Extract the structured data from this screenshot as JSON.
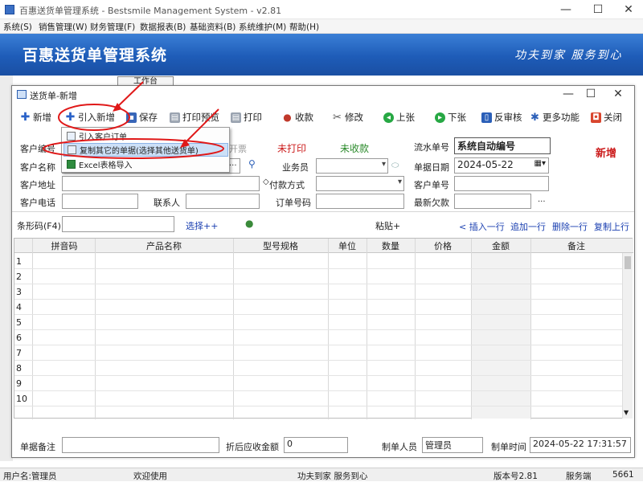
{
  "app": {
    "title": "百惠送货单管理系统 - Bestsmile Management System - v2.81",
    "banner_title": "百惠送货单管理系统",
    "banner_slogan": "功夫到家 服务到心"
  },
  "menu": [
    "系统(S)",
    "销售管理(W)",
    "财务管理(F)",
    "数据报表(B)",
    "基础资料(B)",
    "系统维护(M)",
    "帮助(H)"
  ],
  "behind_tab": "工作台",
  "child": {
    "title": "送货单-新增",
    "min_label": "—",
    "max_label": "☐",
    "close_label": "✕"
  },
  "window_controls": {
    "min": "—",
    "max": "☐",
    "close": "✕"
  },
  "toolbar": {
    "new": "新增",
    "import_new": "引入新增",
    "save": "保存",
    "print_preview": "打印预览",
    "print": "打印",
    "receive": "收款",
    "modify": "修改",
    "up": "上张",
    "down": "下张",
    "reverse": "反审核",
    "more": "更多功能",
    "close": "关闭"
  },
  "popup": {
    "items": [
      "引入客户订单",
      "复制其它的单据(选择其他送货单)",
      "Excel表格导入"
    ]
  },
  "form": {
    "customer_code_label": "客户编号",
    "customer_name_label": "客户名称",
    "customer_addr_label": "客户地址",
    "customer_phone_label": "客户电话",
    "contact_label": "联系人",
    "invoice_label": "开票",
    "print_status": "未打印",
    "receive_status": "未收款",
    "serial_label": "流水单号",
    "serial_value": "系统自动编号",
    "new_tag": "新增",
    "salesman_label": "业务员",
    "doc_date_label": "单据日期",
    "doc_date_value": "2024-05-22",
    "payment_label": "付款方式",
    "customer_order_label": "客户单号",
    "order_no_label": "订单号码",
    "latest_debt_label": "最新欠款",
    "ellipsis": "..."
  },
  "barcode": {
    "label": "条形码(F4)",
    "select_more": "选择++",
    "paste": "粘贴+",
    "insert_row": "< 插入一行",
    "append_row": "追加一行",
    "delete_row": "删除一行",
    "copy_row": "复制上行"
  },
  "grid": {
    "columns": [
      "拼音码",
      "产品名称",
      "型号规格",
      "单位",
      "数量",
      "价格",
      "金额",
      "备注"
    ],
    "row_numbers": [
      "1",
      "2",
      "3",
      "4",
      "5",
      "6",
      "7",
      "8",
      "9",
      "10"
    ]
  },
  "footer": {
    "remark_label": "单据备注",
    "discount_label": "折后应收金额",
    "discount_value": "0",
    "maker_label": "制单人员",
    "maker_value": "管理员",
    "time_label": "制单时间",
    "time_value": "2024-05-22 17:31:57"
  },
  "status": {
    "user": "用户名:管理员",
    "welcome": "欢迎使用",
    "slogan": "功夫到家 服务到心",
    "version": "版本号2.81",
    "server": "服务端",
    "port": "5661"
  },
  "colors": {
    "banner": "#1e5cb8",
    "annotation_red": "#e01818",
    "print_status": "#cc1e1e",
    "receive_status": "#2b8a2b"
  }
}
